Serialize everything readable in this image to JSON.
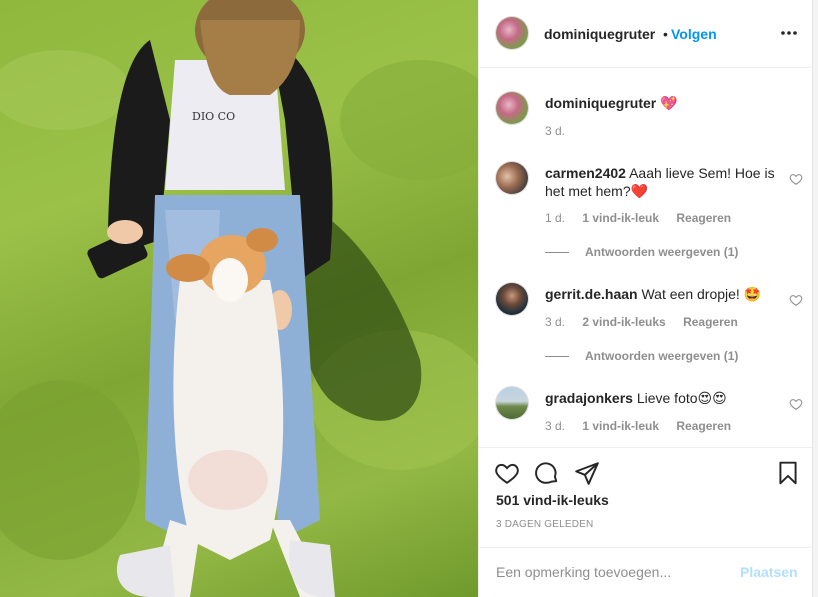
{
  "post": {
    "owner": "dominiquegruter",
    "separator": "•",
    "follow_label": "Volgen",
    "caption_emoji": "💖",
    "caption_time": "3 d."
  },
  "comments": [
    {
      "user": "carmen2402",
      "text": "Aaah lieve Sem! Hoe is het met hem?",
      "emoji": "❤️",
      "time": "1 d.",
      "likes": "1 vind-ik-leuk",
      "reply_label": "Reageren",
      "view_replies": "Antwoorden weergeven (1)"
    },
    {
      "user": "gerrit.de.haan",
      "text": "Wat een dropje!",
      "emoji": "🤩",
      "time": "3 d.",
      "likes": "2 vind-ik-leuks",
      "reply_label": "Reageren",
      "view_replies": "Antwoorden weergeven (1)"
    },
    {
      "user": "gradajonkers",
      "text": "Lieve foto",
      "emoji": "😍😍",
      "time": "3 d.",
      "likes": "1 vind-ik-leuk",
      "reply_label": "Reageren"
    }
  ],
  "actions": {
    "likes_count": "501 vind-ik-leuks",
    "posted_date": "3 DAGEN GELEDEN"
  },
  "add_comment": {
    "placeholder": "Een opmerking toevoegen...",
    "post_label": "Plaatsen"
  },
  "icons": [
    "more-icon",
    "heart-icon",
    "comment-icon",
    "share-icon",
    "bookmark-icon",
    "like-comment-icon"
  ],
  "colors": {
    "link": "#0095f6",
    "muted": "#8e8e8e",
    "text": "#262626",
    "post_disabled": "#b2dffc",
    "heart_red": "#ed4956"
  }
}
